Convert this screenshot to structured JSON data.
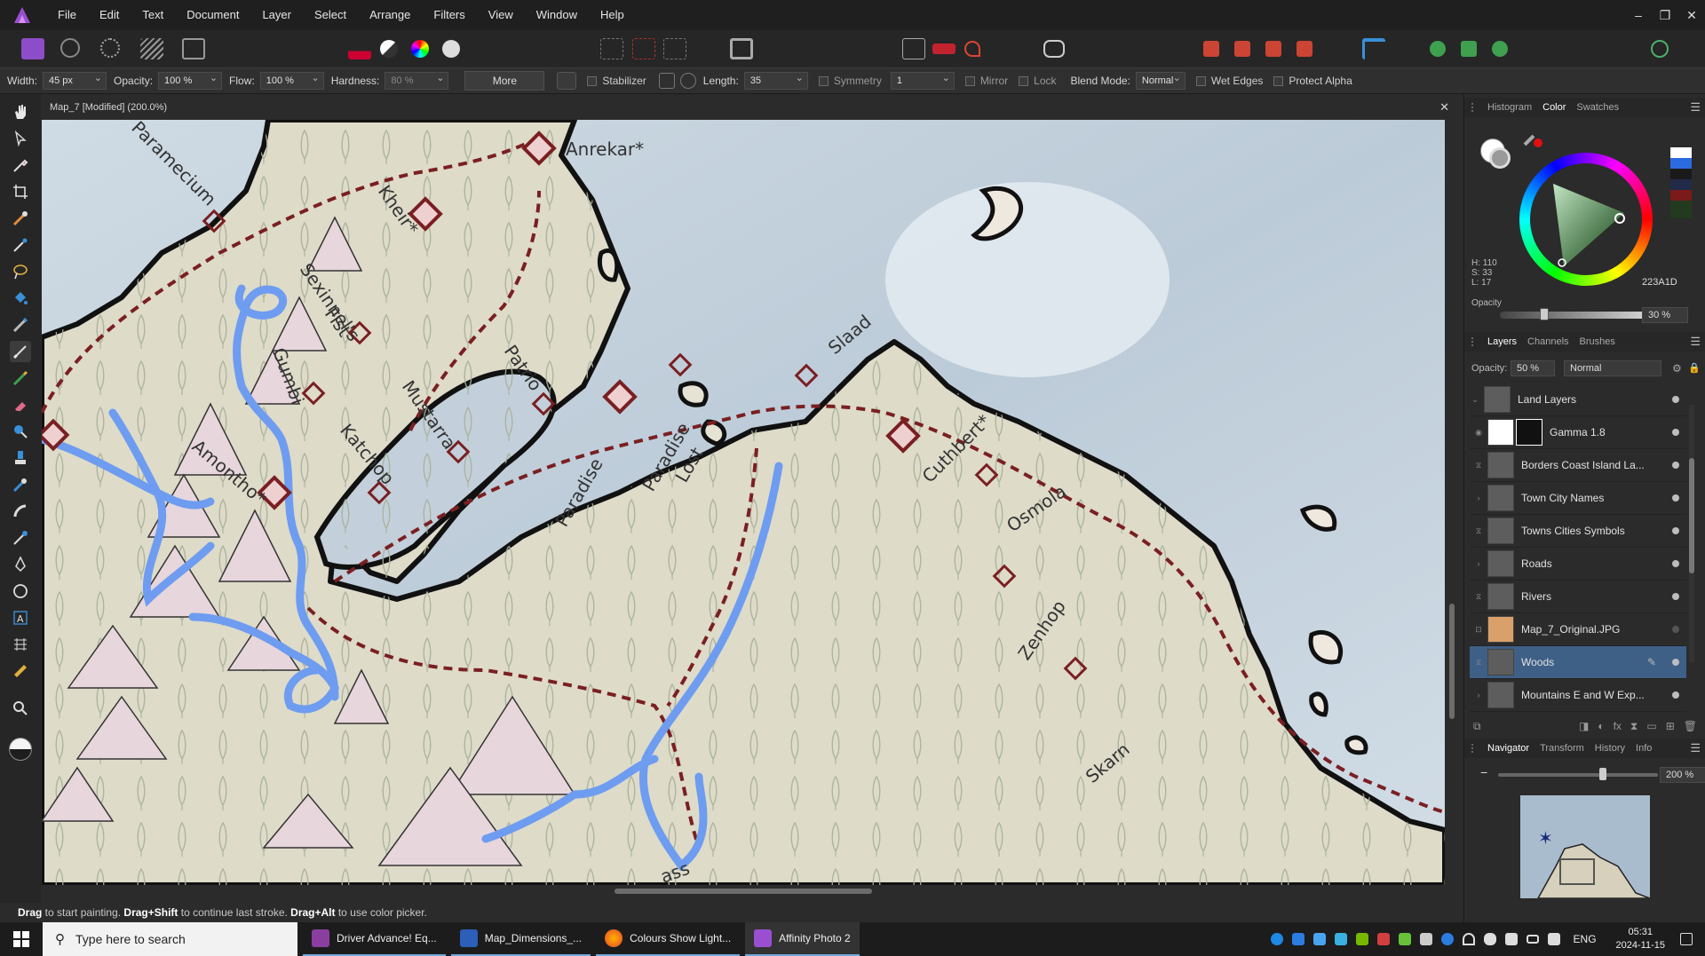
{
  "app": {
    "menu": [
      "File",
      "Edit",
      "Text",
      "Document",
      "Layer",
      "Select",
      "Arrange",
      "Filters",
      "View",
      "Window",
      "Help"
    ],
    "window_controls": {
      "minimize": "–",
      "restore": "❐",
      "close": "✕"
    }
  },
  "context_toolbar": {
    "width_label": "Width:",
    "width_value": "45 px",
    "opacity_label": "Opacity:",
    "opacity_value": "100 %",
    "flow_label": "Flow:",
    "flow_value": "100 %",
    "hardness_label": "Hardness:",
    "hardness_value": "80 %",
    "more_label": "More",
    "stabilizer_label": "Stabilizer",
    "length_label": "Length:",
    "length_value": "35",
    "symmetry_label": "Symmetry",
    "symmetry_value": "1",
    "mirror_label": "Mirror",
    "lock_label": "Lock",
    "blend_label": "Blend Mode:",
    "blend_value": "Normal",
    "wet_edges_label": "Wet Edges",
    "protect_alpha_label": "Protect Alpha"
  },
  "document": {
    "title": "Map_7 [Modified] (200.0%)",
    "close": "✕"
  },
  "map": {
    "labels": {
      "paramecium": "Paramecium",
      "kheir": "Kheir*",
      "anrekar": "Anrekar*",
      "sexinnels": "Sexinnel's",
      "fist": "Fist",
      "gumbi": "Gumbi",
      "patrio": "Patrio",
      "mustarra": "Mustarra",
      "katchop": "Katchop",
      "amontho": "Amontho*",
      "paradise": "Paradise",
      "paradise_lost_1": "Paradise",
      "paradise_lost_2": "Lost",
      "slaad": "Slaad",
      "cuthbert": "Cuthbert*",
      "osmola": "Osmola",
      "zenhop": "Zenhop",
      "skarn": "Skarn",
      "bottom": "ass"
    }
  },
  "status_bar": {
    "b1": "Drag",
    "t1": " to start painting. ",
    "b2": "Drag+Shift",
    "t2": " to continue last stroke. ",
    "b3": "Drag+Alt",
    "t3": " to use color picker."
  },
  "color_panel": {
    "tabs": [
      "Histogram",
      "Color",
      "Swatches"
    ],
    "h": "H: 110",
    "s": "S: 33",
    "l": "L: 17",
    "hex": "223A1D",
    "opacity_label": "Opacity",
    "opacity_value": "30 %",
    "current_color": "#223A1D"
  },
  "layers_panel": {
    "tabs": [
      "Layers",
      "Channels",
      "Brushes"
    ],
    "opacity_label": "Opacity:",
    "opacity_value": "50 %",
    "blend_value": "Normal",
    "layers": [
      {
        "name": "Land Layers"
      },
      {
        "name": "Gamma 1.8"
      },
      {
        "name": "Borders Coast Island La..."
      },
      {
        "name": "Town City Names"
      },
      {
        "name": "Towns Cities Symbols"
      },
      {
        "name": "Roads"
      },
      {
        "name": "Rivers"
      },
      {
        "name": "Map_7_Original.JPG"
      },
      {
        "name": "Woods"
      },
      {
        "name": "Mountains E and W Exp..."
      }
    ]
  },
  "navigator_panel": {
    "tabs": [
      "Navigator",
      "Transform",
      "History",
      "Info"
    ],
    "zoom": "200 %"
  },
  "taskbar": {
    "search_placeholder": "Type here to search",
    "apps": [
      "Driver Advance! Eq...",
      "Map_Dimensions_...",
      "Colours Show Light...",
      "Affinity Photo 2"
    ],
    "lang": "ENG",
    "time": "05:31",
    "date": "2024-11-15"
  }
}
